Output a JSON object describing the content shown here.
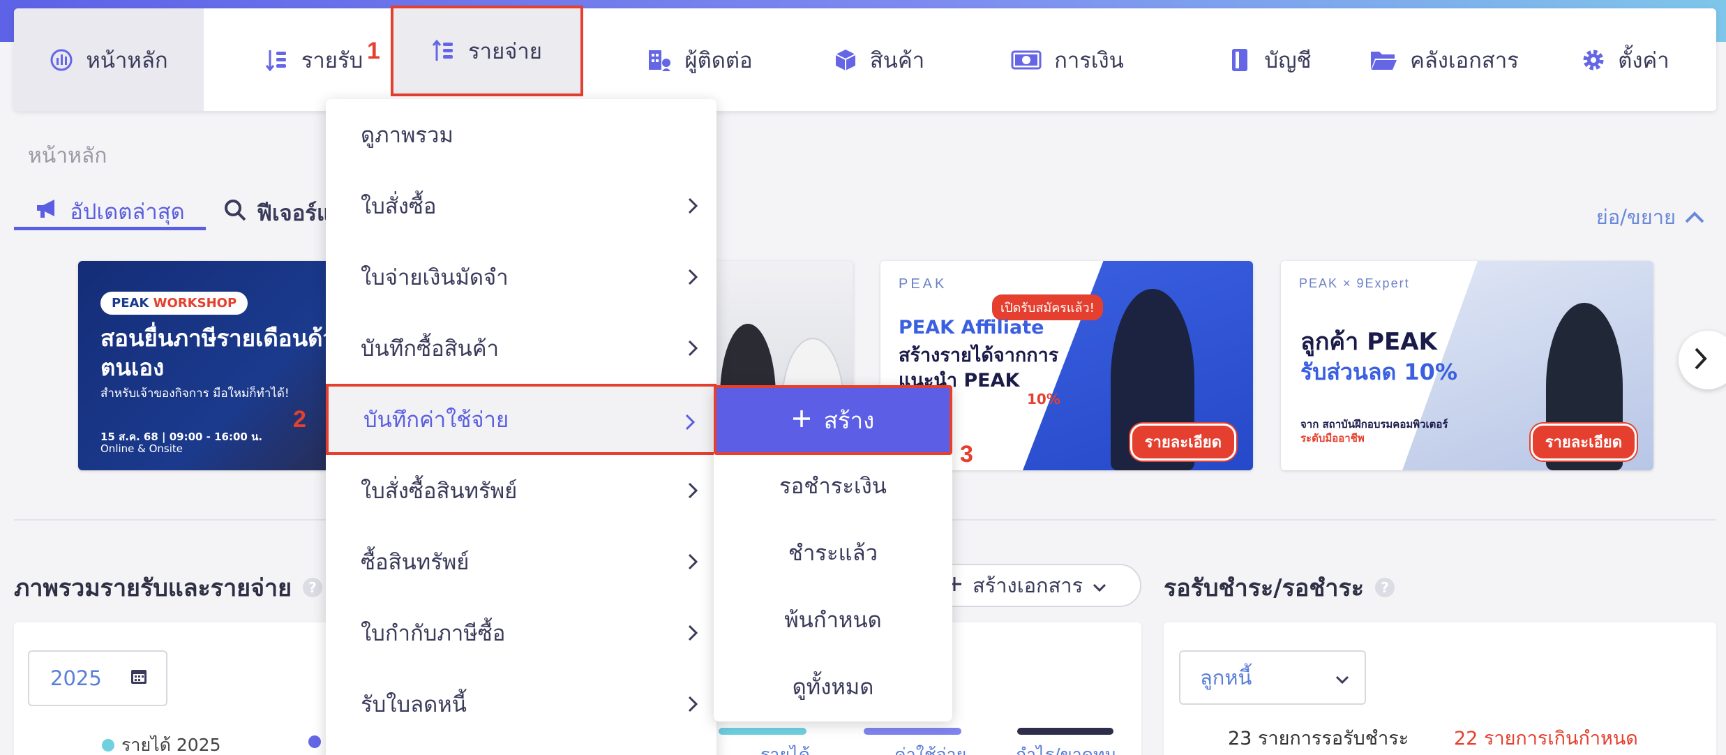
{
  "nav": {
    "items": [
      {
        "label": "หน้าหลัก",
        "icon": "dashboard-icon"
      },
      {
        "label": "รายรับ",
        "icon": "income-icon"
      },
      {
        "label": "รายจ่าย",
        "icon": "expense-icon"
      },
      {
        "label": "ผู้ติดต่อ",
        "icon": "contacts-icon"
      },
      {
        "label": "สินค้า",
        "icon": "product-box-icon"
      },
      {
        "label": "การเงิน",
        "icon": "money-icon"
      },
      {
        "label": "บัญชี",
        "icon": "ledger-icon"
      },
      {
        "label": "คลังเอกสาร",
        "icon": "folder-icon"
      },
      {
        "label": "ตั้งค่า",
        "icon": "gear-icon"
      }
    ]
  },
  "annotations": {
    "step1": "1",
    "step2": "2",
    "step3": "3"
  },
  "breadcrumb": "หน้าหลัก",
  "tabs": {
    "updates": "อัปเดตล่าสุด",
    "features": "ฟีเจอร์แ"
  },
  "collapse_label": "ย่อ/ขยาย",
  "banners": {
    "workshop": {
      "pill_a": "PEAK",
      "pill_b": "WORKSHOP",
      "title": "สอนยื่นภาษีรายเดือนด้วยตนเอง",
      "subtitle": "สำหรับเจ้าของกิจการ มือใหม่ก็ทำได้!",
      "date": "15 ส.ค. 68 | 09:00 - 16:00 น.",
      "mode": "Online & Onsite"
    },
    "affiliate": {
      "logo": "PEAK",
      "pill": "เปิดรับสมัครแล้ว!",
      "title1": "PEAK Affiliate",
      "title2": "สร้างรายได้จากการแนะนำ PEAK",
      "pct": "10%",
      "button": "รายละเอียด"
    },
    "expert": {
      "logo": "PEAK × 9Expert",
      "title1": "ลูกค้า PEAK",
      "title2": "รับส่วนลด 10%",
      "sub1": "จาก สถาบันฝึกอบรมคอมพิวเตอร์",
      "sub2": "ระดับมืออาชีพ",
      "button": "รายละเอียด"
    }
  },
  "dropdown": {
    "items": [
      {
        "label": "ดูภาพรวม",
        "has_sub": false
      },
      {
        "label": "ใบสั่งซื้อ",
        "has_sub": true
      },
      {
        "label": "ใบจ่ายเงินมัดจำ",
        "has_sub": true
      },
      {
        "label": "บันทึกซื้อสินค้า",
        "has_sub": true
      },
      {
        "label": "บันทึกค่าใช้จ่าย",
        "has_sub": true
      },
      {
        "label": "ใบสั่งซื้อสินทรัพย์",
        "has_sub": true
      },
      {
        "label": "ซื้อสินทรัพย์",
        "has_sub": true
      },
      {
        "label": "ใบกำกับภาษีซื้อ",
        "has_sub": true
      },
      {
        "label": "รับใบลดหนี้",
        "has_sub": true
      }
    ]
  },
  "submenu": {
    "create": "สร้าง",
    "items": [
      "รอชำระเงิน",
      "ชำระแล้ว",
      "พ้นกำหนด",
      "ดูทั้งหมด"
    ]
  },
  "overview": {
    "title": "ภาพรวมรายรับและรายจ่าย",
    "year": "2025",
    "legend_income": "รายได้ 2025",
    "create_doc": "สร้างเอกสาร",
    "bar_labels": [
      "รายได้",
      "ค่าใช้จ่าย",
      "กำไร/ขาดทุน"
    ]
  },
  "receivables": {
    "title": "รอรับชำระ/รอชำระ",
    "debtor": "ลูกหนี้",
    "pending": "23 รายการรอรับชำระ",
    "overdue": "22 รายการเกินกำหนด"
  },
  "colors": {
    "accent": "#5c5fe6",
    "highlight": "#e5402f",
    "link": "#5a7ed8"
  }
}
